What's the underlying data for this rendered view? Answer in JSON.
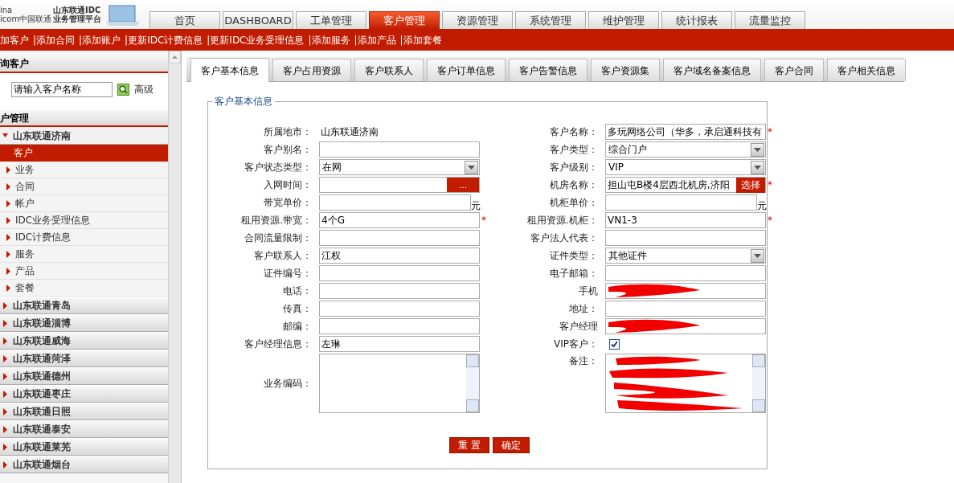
{
  "logo": {
    "brand_lines": [
      "ina",
      "icom中国联通"
    ],
    "platform_lines": [
      "山东联通IDC",
      "业务管理平台"
    ]
  },
  "main_nav": [
    {
      "label": "首页",
      "selected": false
    },
    {
      "label": "DASHBOARD",
      "selected": false
    },
    {
      "label": "工单管理",
      "selected": false
    },
    {
      "label": "客户管理",
      "selected": true
    },
    {
      "label": "资源管理",
      "selected": false
    },
    {
      "label": "系统管理",
      "selected": false
    },
    {
      "label": "维护管理",
      "selected": false
    },
    {
      "label": "统计报表",
      "selected": false
    },
    {
      "label": "流量监控",
      "selected": false
    }
  ],
  "action_links": [
    "加客户",
    "|添加合同",
    "|添加账户",
    "|更新IDC计费信息",
    "|更新IDC业务受理信息",
    "|添加服务",
    "|添加产品",
    "|添加套餐"
  ],
  "sidebar": {
    "search_title": "询客户",
    "search": {
      "placeholder": "请输入客户名称"
    },
    "advanced": "高级",
    "tree_title": "户管理",
    "groups": [
      {
        "label": "山东联通济南",
        "expanded": true,
        "children": [
          {
            "label": "客户",
            "selected": true
          },
          {
            "label": "业务",
            "selected": false
          },
          {
            "label": "合同",
            "selected": false
          },
          {
            "label": "帐户",
            "selected": false
          },
          {
            "label": "IDC业务受理信息",
            "selected": false
          },
          {
            "label": "IDC计费信息",
            "selected": false
          },
          {
            "label": "服务",
            "selected": false
          },
          {
            "label": "产品",
            "selected": false
          },
          {
            "label": "套餐",
            "selected": false
          }
        ]
      },
      {
        "label": "山东联通青岛",
        "expanded": false
      },
      {
        "label": "山东联通淄博",
        "expanded": false
      },
      {
        "label": "山东联通威海",
        "expanded": false
      },
      {
        "label": "山东联通菏泽",
        "expanded": false
      },
      {
        "label": "山东联通德州",
        "expanded": false
      },
      {
        "label": "山东联通枣庄",
        "expanded": false
      },
      {
        "label": "山东联通日照",
        "expanded": false
      },
      {
        "label": "山东联通泰安",
        "expanded": false
      },
      {
        "label": "山东联通莱芜",
        "expanded": false
      },
      {
        "label": "山东联通烟台",
        "expanded": false
      }
    ]
  },
  "content_tabs": [
    {
      "label": "客户基本信息",
      "selected": true
    },
    {
      "label": "客户占用资源",
      "selected": false
    },
    {
      "label": "客户联系人",
      "selected": false
    },
    {
      "label": "客户订单信息",
      "selected": false
    },
    {
      "label": "客户告警信息",
      "selected": false
    },
    {
      "label": "客户资源集",
      "selected": false
    },
    {
      "label": "客户域名备案信息",
      "selected": false
    },
    {
      "label": "客户合同",
      "selected": false
    },
    {
      "label": "客户相关信息",
      "selected": false
    }
  ],
  "form": {
    "legend": "客户基本信息",
    "required_mark": "*",
    "left": [
      {
        "kind": "static",
        "label": "所属地市：",
        "value": "山东联通济南"
      },
      {
        "kind": "text",
        "label": "客户别名：",
        "required": false
      },
      {
        "kind": "select",
        "label": "客户状态类型：",
        "value": "在网"
      },
      {
        "kind": "date",
        "label": "入网时间：",
        "button": "..."
      },
      {
        "kind": "price",
        "label": "带宽单价：",
        "unit": "元"
      },
      {
        "kind": "text",
        "label": "租用资源.带宽：",
        "value": "4个G",
        "required": true
      },
      {
        "kind": "text",
        "label": "合同流量限制：",
        "required": false
      },
      {
        "kind": "text",
        "label": "客户联系人：",
        "value": "江权",
        "required": false
      },
      {
        "kind": "text",
        "label": "证件编号：",
        "required": false
      },
      {
        "kind": "text",
        "label": "电话：",
        "required": false
      },
      {
        "kind": "text",
        "label": "传真：",
        "required": false
      },
      {
        "kind": "text",
        "label": "邮编：",
        "required": false
      },
      {
        "kind": "text",
        "label": "客户经理信息：",
        "value": "左琳",
        "required": false
      },
      {
        "kind": "textarea",
        "label": "业务编码："
      }
    ],
    "right": [
      {
        "kind": "text",
        "label": "客户名称：",
        "value": "多玩网络公司（华多，承启通科技有",
        "required": true
      },
      {
        "kind": "select",
        "label": "客户类型：",
        "value": "综合门户"
      },
      {
        "kind": "select",
        "label": "客户级别：",
        "value": "VIP"
      },
      {
        "kind": "picker",
        "label": "机房名称：",
        "value": "担山屯B楼4层西北机房,济阳",
        "button": "选择",
        "required": true
      },
      {
        "kind": "price",
        "label": "机柜单价：",
        "unit": "元"
      },
      {
        "kind": "text",
        "label": "租用资源.机柜：",
        "value": "VN1-3",
        "required": true
      },
      {
        "kind": "text",
        "label": "客户法人代表：",
        "required": false
      },
      {
        "kind": "select",
        "label": "证件类型：",
        "value": "其他证件"
      },
      {
        "kind": "text",
        "label": "电子邮箱：",
        "required": false
      },
      {
        "kind": "text",
        "label": "手机",
        "required": false,
        "redacted": true
      },
      {
        "kind": "text",
        "label": "地址：",
        "required": false
      },
      {
        "kind": "text",
        "label": "客户经理",
        "required": false,
        "redacted": true
      },
      {
        "kind": "checkbox",
        "label": "VIP客户：",
        "checked": true
      },
      {
        "kind": "textarea",
        "label": "备注：",
        "redacted": true
      }
    ],
    "buttons": [
      "重 置",
      "确定"
    ]
  }
}
